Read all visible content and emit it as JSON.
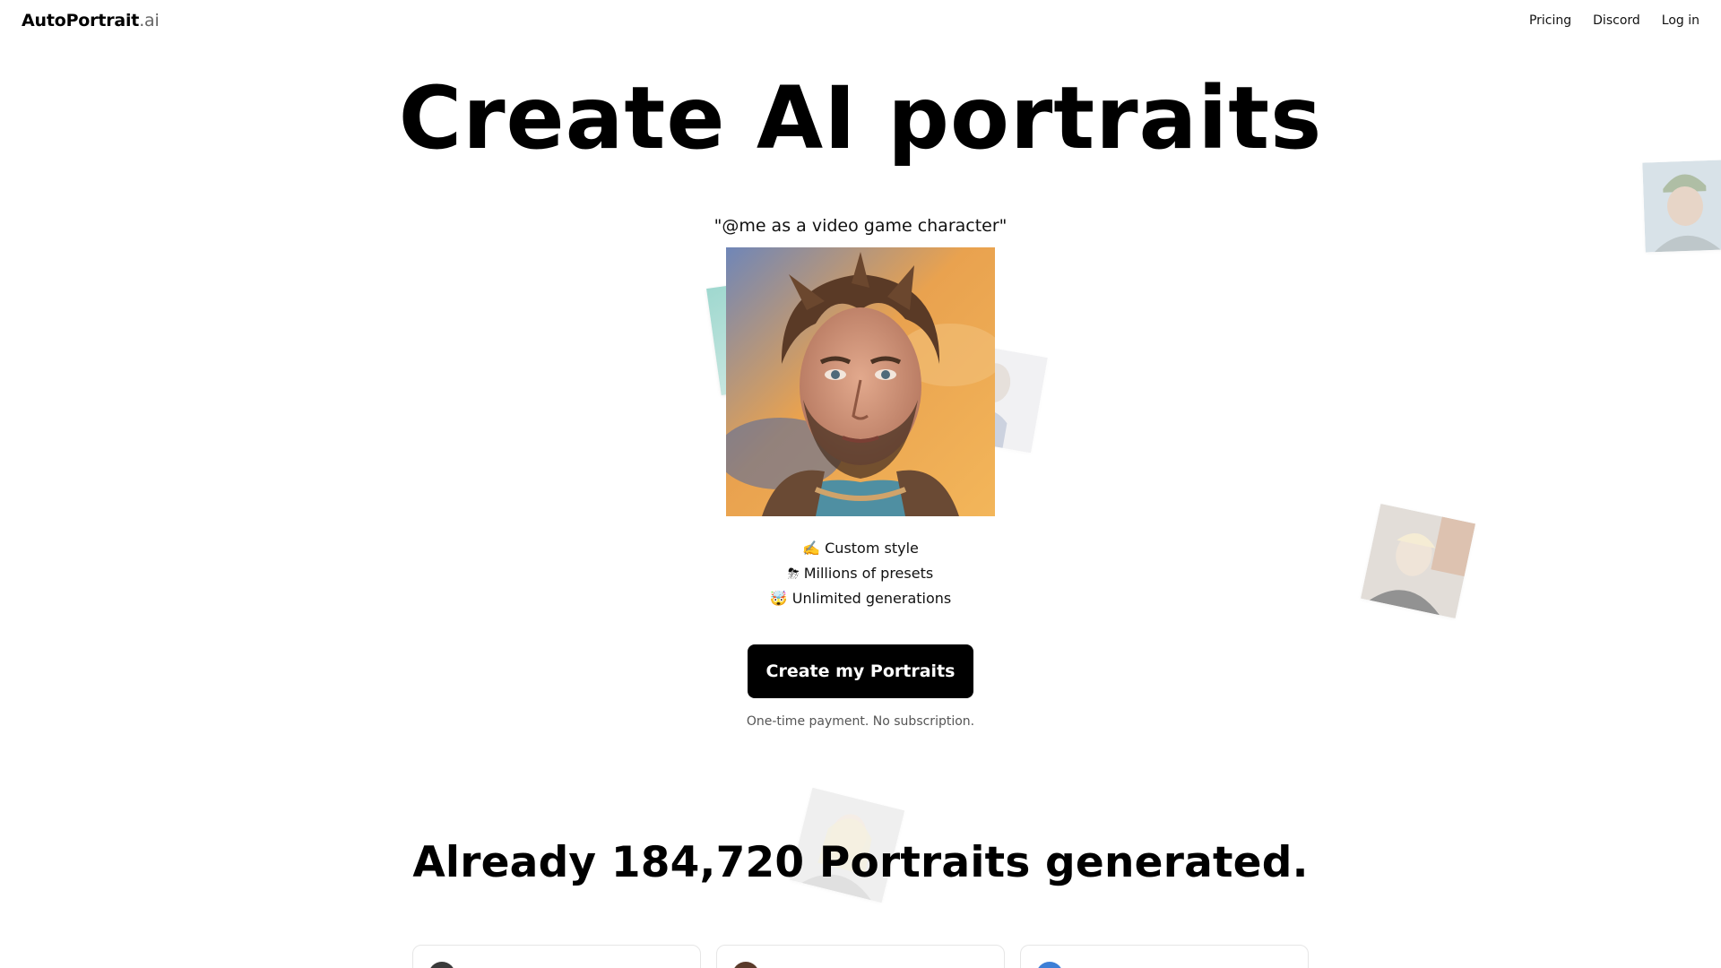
{
  "nav": {
    "logo_main": "AutoPortrait",
    "logo_suffix": ".ai",
    "links": [
      "Pricing",
      "Discord",
      "Log in"
    ]
  },
  "hero": {
    "title": "Create AI portraits",
    "prompt": "\"@me as a video game character\""
  },
  "features": [
    {
      "icon": "writing-hand-icon",
      "emoji": "✍️",
      "label": "Custom style"
    },
    {
      "icon": "cloud-lightning-icon",
      "emoji": "⛈",
      "label": "Millions of presets"
    },
    {
      "icon": "mind-blown-icon",
      "emoji": "🤯",
      "label": "Unlimited generations"
    }
  ],
  "cta": {
    "label": "Create my Portraits",
    "note": "One-time payment. No subscription."
  },
  "stats": {
    "headline": "Already 184,720 Portraits generated."
  },
  "colors": {
    "accent": "#000000",
    "text": "#111111",
    "muted": "#555555"
  }
}
